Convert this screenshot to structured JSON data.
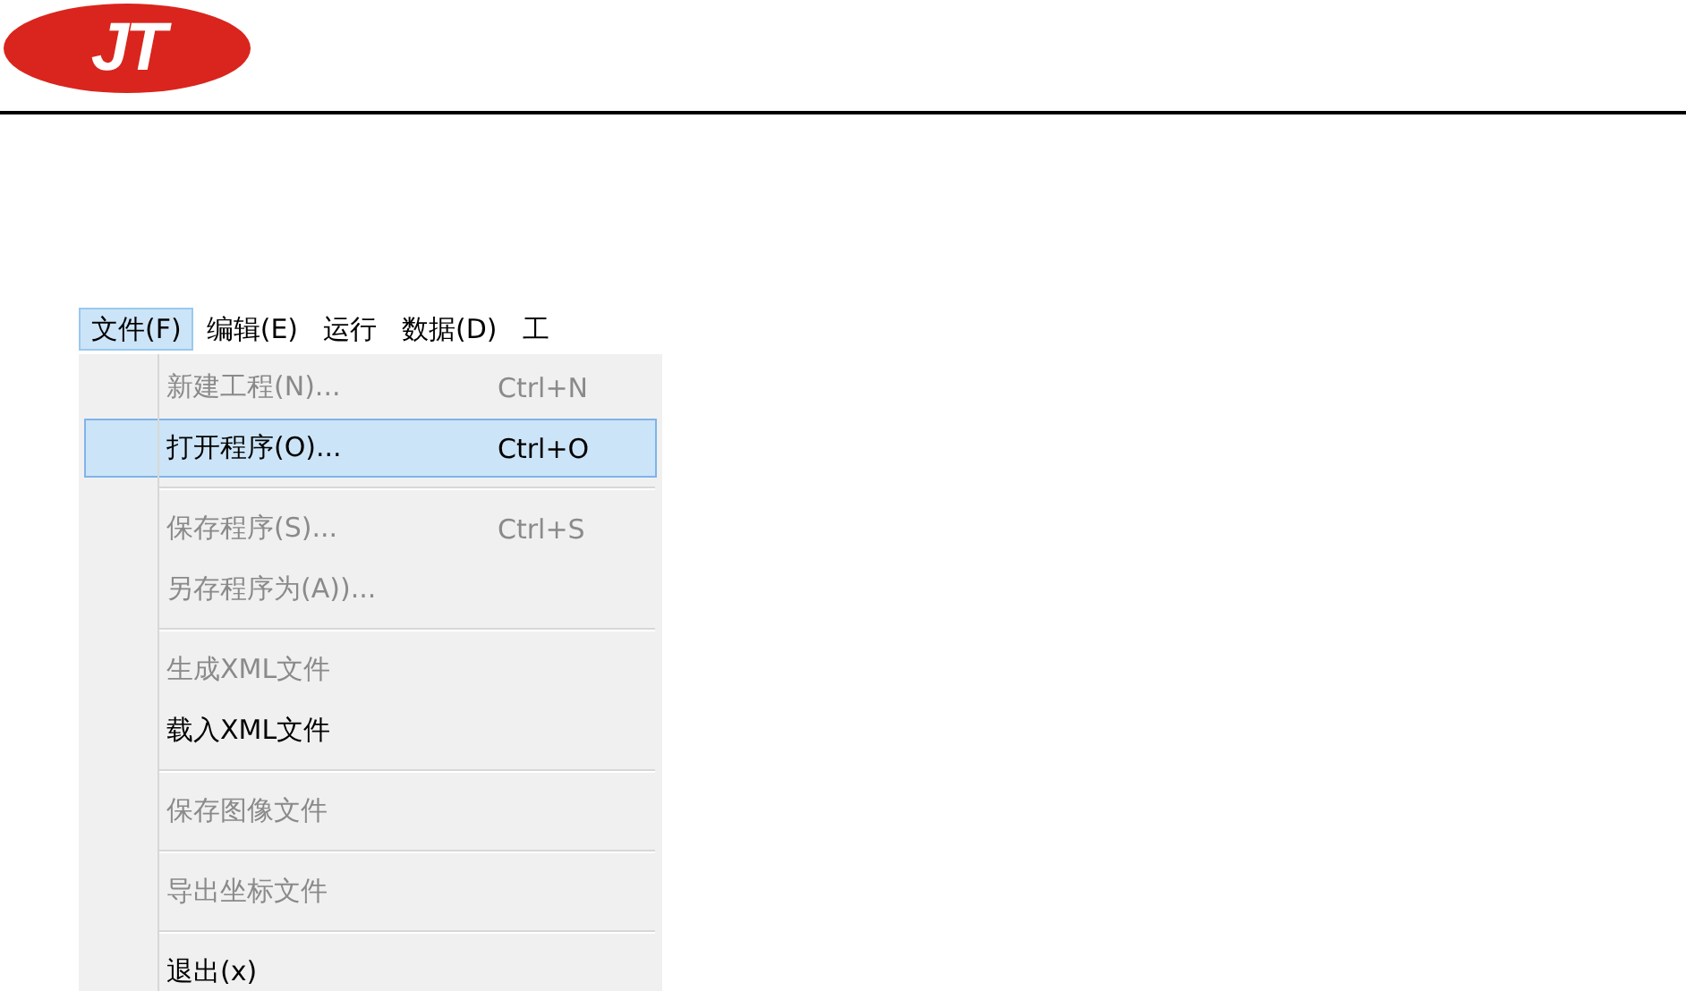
{
  "logo": {
    "text": "JT"
  },
  "menubar": [
    {
      "label": "文件(F)",
      "selected": true
    },
    {
      "label": "编辑(E)",
      "selected": false
    },
    {
      "label": "运行",
      "selected": false
    },
    {
      "label": "数据(D)",
      "selected": false
    },
    {
      "label": "工",
      "selected": false
    }
  ],
  "menu": [
    {
      "kind": "item",
      "label": "新建工程(N)...",
      "shortcut": "Ctrl+N",
      "disabled": true,
      "selected": false
    },
    {
      "kind": "item",
      "label": "打开程序(O)...",
      "shortcut": "Ctrl+O",
      "disabled": false,
      "selected": true
    },
    {
      "kind": "separator"
    },
    {
      "kind": "item",
      "label": "保存程序(S)...",
      "shortcut": "Ctrl+S",
      "disabled": true,
      "selected": false
    },
    {
      "kind": "item",
      "label": "另存程序为(A))...",
      "disabled": true,
      "selected": false
    },
    {
      "kind": "separator"
    },
    {
      "kind": "item",
      "label": "生成XML文件",
      "disabled": true,
      "selected": false
    },
    {
      "kind": "item",
      "label": "载入XML文件",
      "disabled": false,
      "selected": false
    },
    {
      "kind": "separator"
    },
    {
      "kind": "item",
      "label": "保存图像文件",
      "disabled": true,
      "selected": false
    },
    {
      "kind": "separator"
    },
    {
      "kind": "item",
      "label": "导出坐标文件",
      "disabled": true,
      "selected": false
    },
    {
      "kind": "separator"
    },
    {
      "kind": "item",
      "label": "退出(x)",
      "disabled": false,
      "selected": false
    }
  ]
}
